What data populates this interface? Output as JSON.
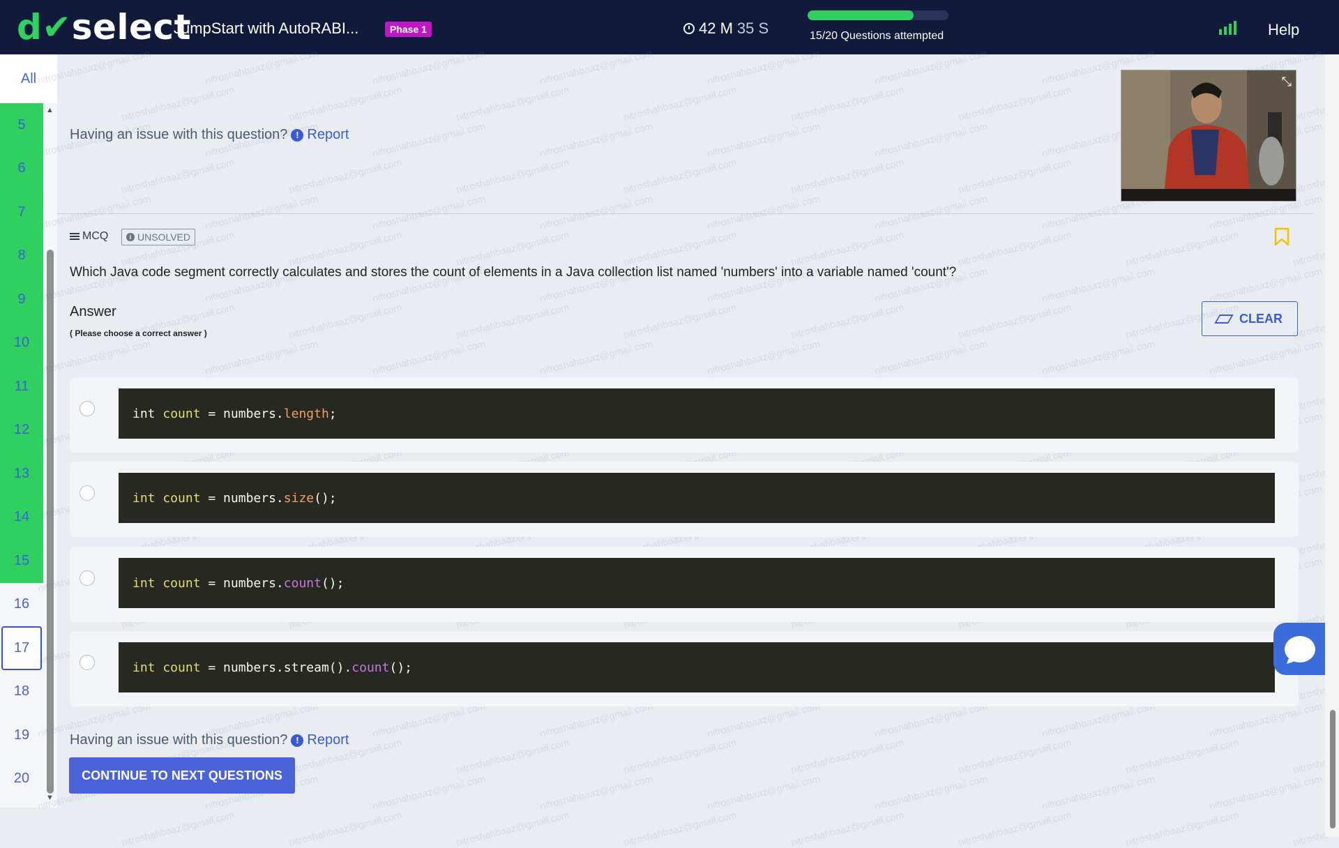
{
  "header": {
    "logo_text": "doselect",
    "test_title": "JumpStart with AutoRABI...",
    "phase_badge": "Phase 1",
    "timer_min": "42 M",
    "timer_sec": "35 S",
    "progress_fraction": 0.75,
    "progress_label": "15/20 Questions attempted",
    "help": "Help"
  },
  "nav": {
    "all_label": "All",
    "items": [
      {
        "label": "5",
        "state": "done"
      },
      {
        "label": "6",
        "state": "done"
      },
      {
        "label": "7",
        "state": "done"
      },
      {
        "label": "8",
        "state": "done"
      },
      {
        "label": "9",
        "state": "done"
      },
      {
        "label": "10",
        "state": "done"
      },
      {
        "label": "11",
        "state": "done"
      },
      {
        "label": "12",
        "state": "done"
      },
      {
        "label": "13",
        "state": "done"
      },
      {
        "label": "14",
        "state": "done"
      },
      {
        "label": "15",
        "state": "done"
      },
      {
        "label": "16",
        "state": "open"
      },
      {
        "label": "17",
        "state": "current"
      },
      {
        "label": "18",
        "state": "open"
      },
      {
        "label": "19",
        "state": "open"
      },
      {
        "label": "20",
        "state": "open"
      }
    ]
  },
  "report": {
    "text": "Having an issue with this question?",
    "link": "Report"
  },
  "question": {
    "type": "MCQ",
    "status": "UNSOLVED",
    "text": "Which Java code segment correctly calculates and stores the count of elements in a Java collection list named 'numbers' into a variable named 'count'?",
    "answer_label": "Answer",
    "answer_hint": "( Please choose a correct answer )",
    "clear_label": "CLEAR"
  },
  "options": [
    {
      "code": "int count = numbers.length;"
    },
    {
      "code": "int count = numbers.size();"
    },
    {
      "code": "int count = numbers.count();"
    },
    {
      "code": "int count = numbers.stream().count();"
    }
  ],
  "continue_label": "CONTINUE TO NEXT QUESTIONS",
  "watermark": "nitroshahbaaz@gmail.com",
  "colors": {
    "header_bg": "#121a3b",
    "accent_green": "#2fd05f",
    "accent_blue": "#4a63d9",
    "phase_badge": "#c016c6",
    "bookmark": "#f2c200"
  }
}
